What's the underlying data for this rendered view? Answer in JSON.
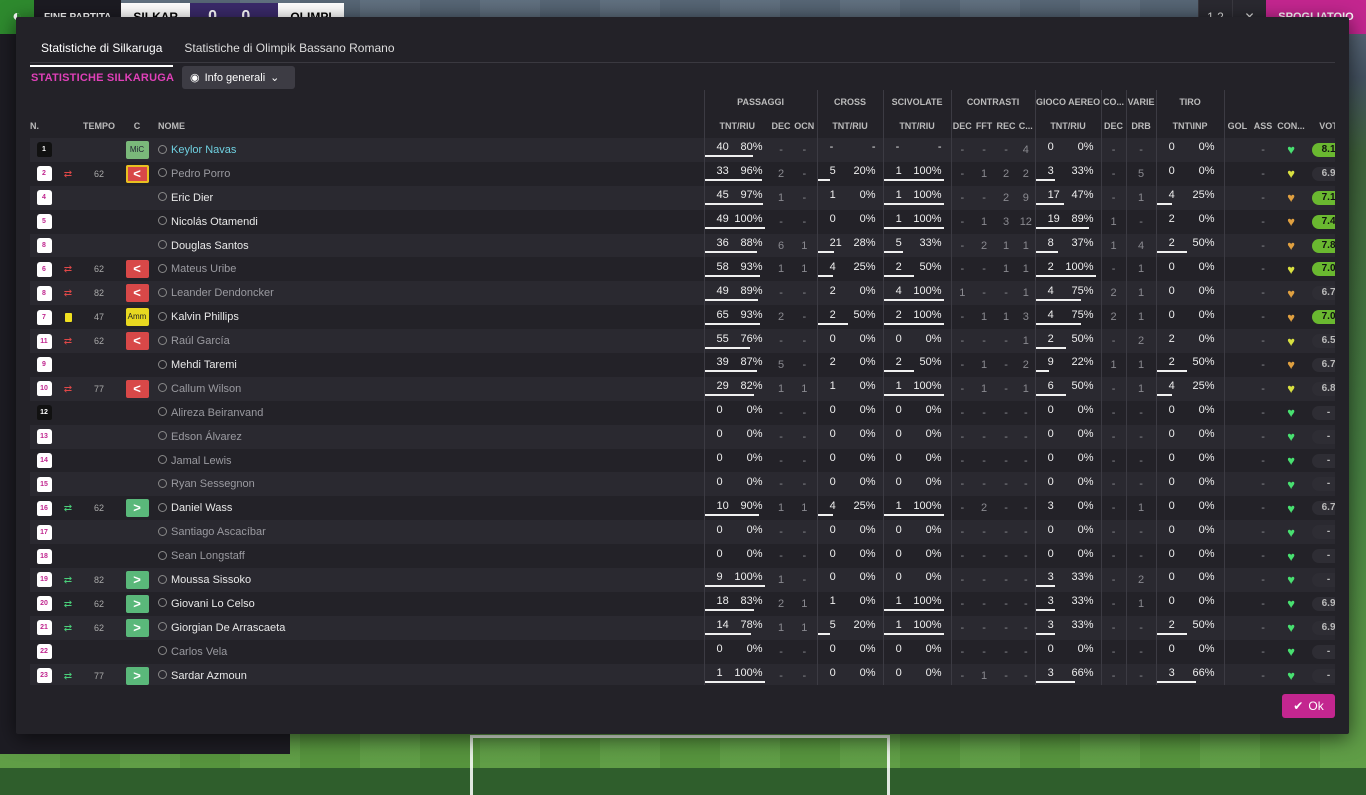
{
  "topbar": {
    "end_label": "FINE PARTITA",
    "home_short": "SILKAR",
    "score": "0 0",
    "away_short": "OLIMPI",
    "right_btn1": "1 2",
    "right_btn2": "✕",
    "right_pink": "SPOGLIATOIO"
  },
  "tabs": [
    {
      "label": "Statistiche di Silkaruga"
    },
    {
      "label": "Statistiche di Olimpik Bassano Romano"
    }
  ],
  "section_title": "STATISTICHE SILKARUGA",
  "dropdown": {
    "label": "Info generali"
  },
  "groups": {
    "passaggi": "PASSAGGI",
    "cross": "CROSS",
    "scivolate": "SCIVOLATE",
    "contrasti": "CONTRASTI",
    "gioco_aereo": "GIOCO AEREO",
    "co": "CO...",
    "varie": "VARIE",
    "tiro": "TIRO"
  },
  "cols": {
    "n": "N.",
    "tempo": "TEMPO",
    "c": "C",
    "nome": "NOME",
    "tnt_riu": "TNT/RIU",
    "dec": "DEC",
    "ocn": "OCN",
    "fft": "FFT",
    "rec": "REC",
    "cx": "C...",
    "drb": "DRB",
    "tnt_inp": "TNT\\INP",
    "gol": "GOL",
    "ass": "ASS",
    "con": "CON...",
    "vot": "VOT"
  },
  "ok_label": "Ok",
  "players": [
    {
      "n": "1",
      "shirt": "black",
      "tempo": "",
      "swap": "",
      "pos": "MiC",
      "pos_type": "gk",
      "name": "Keylor Navas",
      "name_style": "gk",
      "p": [
        "40",
        "80%"
      ],
      "pf": 0.8,
      "pdec": "-",
      "pocn": "-",
      "cr": [
        "-",
        "-"
      ],
      "crf": 0,
      "cr_dash": true,
      "sc": [
        "-",
        "-"
      ],
      "scf": 0,
      "sc_dash": true,
      "cdec": "-",
      "cfft": "-",
      "crec": "-",
      "cc": "4",
      "ga": [
        "0",
        "0%"
      ],
      "gaf": 0,
      "codec": "-",
      "drb": "-",
      "t": [
        "0",
        "0%"
      ],
      "tf": 0,
      "gol": "",
      "ass": "-",
      "heart": "g",
      "vot": "8.1",
      "vot_type": "g"
    },
    {
      "n": "2",
      "shirt": "white",
      "tempo": "62",
      "swap": "out",
      "pos": "<",
      "pos_type": "out-warn",
      "name": "Pedro Porro",
      "name_style": "dim",
      "p": [
        "33",
        "96%"
      ],
      "pf": 0.96,
      "pdec": "2",
      "pocn": "-",
      "cr": [
        "5",
        "20%"
      ],
      "crf": 0.2,
      "sc": [
        "1",
        "100%"
      ],
      "scf": 1,
      "cdec": "-",
      "cfft": "1",
      "crec": "2",
      "cc": "2",
      "ga": [
        "3",
        "33%"
      ],
      "gaf": 0.33,
      "codec": "-",
      "drb": "5",
      "t": [
        "0",
        "0%"
      ],
      "tf": 0,
      "gol": "",
      "ass": "-",
      "heart": "y",
      "vot": "6.9",
      "vot_type": "n"
    },
    {
      "n": "4",
      "shirt": "white",
      "tempo": "",
      "swap": "",
      "pos": "",
      "pos_type": "",
      "name": "Eric Dier",
      "name_style": "",
      "p": [
        "45",
        "97%"
      ],
      "pf": 0.97,
      "pdec": "1",
      "pocn": "-",
      "cr": [
        "1",
        "0%"
      ],
      "crf": 0,
      "sc": [
        "1",
        "100%"
      ],
      "scf": 1,
      "cdec": "-",
      "cfft": "-",
      "crec": "2",
      "cc": "9",
      "ga": [
        "17",
        "47%"
      ],
      "gaf": 0.47,
      "codec": "-",
      "drb": "1",
      "t": [
        "4",
        "25%"
      ],
      "tf": 0.25,
      "gol": "",
      "ass": "-",
      "heart": "o",
      "vot": "7.1",
      "vot_type": "g"
    },
    {
      "n": "5",
      "shirt": "white",
      "tempo": "",
      "swap": "",
      "pos": "",
      "pos_type": "",
      "name": "Nicolás Otamendi",
      "name_style": "",
      "p": [
        "49",
        "100%"
      ],
      "pf": 1,
      "pdec": "-",
      "pocn": "-",
      "cr": [
        "0",
        "0%"
      ],
      "crf": 0,
      "sc": [
        "1",
        "100%"
      ],
      "scf": 1,
      "cdec": "-",
      "cfft": "1",
      "crec": "3",
      "cc": "12",
      "ga": [
        "19",
        "89%"
      ],
      "gaf": 0.89,
      "codec": "1",
      "drb": "-",
      "t": [
        "2",
        "0%"
      ],
      "tf": 0,
      "gol": "",
      "ass": "-",
      "heart": "o",
      "vot": "7.4",
      "vot_type": "g"
    },
    {
      "n": "8",
      "shirt": "white",
      "tempo": "",
      "swap": "",
      "pos": "",
      "pos_type": "",
      "name": "Douglas Santos",
      "name_style": "",
      "p": [
        "36",
        "88%"
      ],
      "pf": 0.88,
      "pdec": "6",
      "pocn": "1",
      "cr": [
        "21",
        "28%"
      ],
      "crf": 0.28,
      "sc": [
        "5",
        "33%"
      ],
      "scf": 0.33,
      "cdec": "-",
      "cfft": "2",
      "crec": "1",
      "cc": "1",
      "ga": [
        "8",
        "37%"
      ],
      "gaf": 0.37,
      "codec": "1",
      "drb": "4",
      "t": [
        "2",
        "50%"
      ],
      "tf": 0.5,
      "gol": "",
      "ass": "-",
      "heart": "o",
      "vot": "7.8",
      "vot_type": "g"
    },
    {
      "n": "6",
      "shirt": "white",
      "tempo": "62",
      "swap": "out",
      "pos": "<",
      "pos_type": "out",
      "name": "Mateus Uribe",
      "name_style": "dim",
      "p": [
        "58",
        "93%"
      ],
      "pf": 0.93,
      "pdec": "1",
      "pocn": "1",
      "cr": [
        "4",
        "25%"
      ],
      "crf": 0.25,
      "sc": [
        "2",
        "50%"
      ],
      "scf": 0.5,
      "cdec": "-",
      "cfft": "-",
      "crec": "1",
      "cc": "1",
      "ga": [
        "2",
        "100%"
      ],
      "gaf": 1,
      "codec": "-",
      "drb": "1",
      "t": [
        "0",
        "0%"
      ],
      "tf": 0,
      "gol": "",
      "ass": "-",
      "heart": "y",
      "vot": "7.0",
      "vot_type": "g"
    },
    {
      "n": "8",
      "shirt": "white",
      "tempo": "82",
      "swap": "out",
      "pos": "<",
      "pos_type": "out",
      "name": "Leander Dendoncker",
      "name_style": "dim",
      "p": [
        "49",
        "89%"
      ],
      "pf": 0.89,
      "pdec": "-",
      "pocn": "-",
      "cr": [
        "2",
        "0%"
      ],
      "crf": 0,
      "sc": [
        "4",
        "100%"
      ],
      "scf": 1,
      "cdec": "1",
      "cfft": "-",
      "crec": "-",
      "cc": "1",
      "ga": [
        "4",
        "75%"
      ],
      "gaf": 0.75,
      "codec": "2",
      "drb": "1",
      "t": [
        "0",
        "0%"
      ],
      "tf": 0,
      "gol": "",
      "ass": "-",
      "heart": "o",
      "vot": "6.7",
      "vot_type": "n"
    },
    {
      "n": "7",
      "shirt": "white",
      "tempo": "47",
      "swap": "yellow",
      "pos": "Amm",
      "pos_type": "y",
      "name": "Kalvin Phillips",
      "name_style": "",
      "p": [
        "65",
        "93%"
      ],
      "pf": 0.93,
      "pdec": "2",
      "pocn": "-",
      "cr": [
        "2",
        "50%"
      ],
      "crf": 0.5,
      "sc": [
        "2",
        "100%"
      ],
      "scf": 1,
      "cdec": "-",
      "cfft": "1",
      "crec": "1",
      "cc": "3",
      "ga": [
        "4",
        "75%"
      ],
      "gaf": 0.75,
      "codec": "2",
      "drb": "1",
      "t": [
        "0",
        "0%"
      ],
      "tf": 0,
      "gol": "",
      "ass": "-",
      "heart": "o",
      "vot": "7.0",
      "vot_type": "g"
    },
    {
      "n": "11",
      "shirt": "white",
      "tempo": "62",
      "swap": "out",
      "pos": "<",
      "pos_type": "out",
      "name": "Raúl García",
      "name_style": "dim",
      "p": [
        "55",
        "76%"
      ],
      "pf": 0.76,
      "pdec": "-",
      "pocn": "-",
      "cr": [
        "0",
        "0%"
      ],
      "crf": 0,
      "sc": [
        "0",
        "0%"
      ],
      "scf": 0,
      "cdec": "-",
      "cfft": "-",
      "crec": "-",
      "cc": "1",
      "ga": [
        "2",
        "50%"
      ],
      "gaf": 0.5,
      "codec": "-",
      "drb": "2",
      "t": [
        "2",
        "0%"
      ],
      "tf": 0,
      "gol": "",
      "ass": "-",
      "heart": "y",
      "vot": "6.5",
      "vot_type": "n"
    },
    {
      "n": "9",
      "shirt": "white",
      "tempo": "",
      "swap": "",
      "pos": "",
      "pos_type": "",
      "name": "Mehdi Taremi",
      "name_style": "",
      "p": [
        "39",
        "87%"
      ],
      "pf": 0.87,
      "pdec": "5",
      "pocn": "-",
      "cr": [
        "2",
        "0%"
      ],
      "crf": 0,
      "sc": [
        "2",
        "50%"
      ],
      "scf": 0.5,
      "cdec": "-",
      "cfft": "1",
      "crec": "-",
      "cc": "2",
      "ga": [
        "9",
        "22%"
      ],
      "gaf": 0.22,
      "codec": "1",
      "drb": "1",
      "t": [
        "2",
        "50%"
      ],
      "tf": 0.5,
      "gol": "",
      "ass": "-",
      "heart": "o",
      "vot": "6.7",
      "vot_type": "n"
    },
    {
      "n": "10",
      "shirt": "white",
      "tempo": "77",
      "swap": "out",
      "pos": "<",
      "pos_type": "out",
      "name": "Callum Wilson",
      "name_style": "dim",
      "p": [
        "29",
        "82%"
      ],
      "pf": 0.82,
      "pdec": "1",
      "pocn": "1",
      "cr": [
        "1",
        "0%"
      ],
      "crf": 0,
      "sc": [
        "1",
        "100%"
      ],
      "scf": 1,
      "cdec": "-",
      "cfft": "1",
      "crec": "-",
      "cc": "1",
      "ga": [
        "6",
        "50%"
      ],
      "gaf": 0.5,
      "codec": "-",
      "drb": "1",
      "t": [
        "4",
        "25%"
      ],
      "tf": 0.25,
      "gol": "",
      "ass": "-",
      "heart": "y",
      "vot": "6.8",
      "vot_type": "n"
    },
    {
      "n": "12",
      "shirt": "black",
      "tempo": "",
      "swap": "",
      "pos": "",
      "pos_type": "",
      "name": "Alireza Beiranvand",
      "name_style": "dim",
      "p": [
        "0",
        "0%"
      ],
      "pf": 0,
      "pdec": "-",
      "pocn": "-",
      "cr": [
        "0",
        "0%"
      ],
      "crf": 0,
      "sc": [
        "0",
        "0%"
      ],
      "scf": 0,
      "cdec": "-",
      "cfft": "-",
      "crec": "-",
      "cc": "-",
      "ga": [
        "0",
        "0%"
      ],
      "gaf": 0,
      "codec": "-",
      "drb": "-",
      "t": [
        "0",
        "0%"
      ],
      "tf": 0,
      "gol": "",
      "ass": "-",
      "heart": "g",
      "vot": "-",
      "vot_type": "n"
    },
    {
      "n": "13",
      "shirt": "white",
      "tempo": "",
      "swap": "",
      "pos": "",
      "pos_type": "",
      "name": "Edson Álvarez",
      "name_style": "dim",
      "p": [
        "0",
        "0%"
      ],
      "pf": 0,
      "pdec": "-",
      "pocn": "-",
      "cr": [
        "0",
        "0%"
      ],
      "crf": 0,
      "sc": [
        "0",
        "0%"
      ],
      "scf": 0,
      "cdec": "-",
      "cfft": "-",
      "crec": "-",
      "cc": "-",
      "ga": [
        "0",
        "0%"
      ],
      "gaf": 0,
      "codec": "-",
      "drb": "-",
      "t": [
        "0",
        "0%"
      ],
      "tf": 0,
      "gol": "",
      "ass": "-",
      "heart": "g",
      "vot": "-",
      "vot_type": "n"
    },
    {
      "n": "14",
      "shirt": "white",
      "tempo": "",
      "swap": "",
      "pos": "",
      "pos_type": "",
      "name": "Jamal Lewis",
      "name_style": "dim",
      "p": [
        "0",
        "0%"
      ],
      "pf": 0,
      "pdec": "-",
      "pocn": "-",
      "cr": [
        "0",
        "0%"
      ],
      "crf": 0,
      "sc": [
        "0",
        "0%"
      ],
      "scf": 0,
      "cdec": "-",
      "cfft": "-",
      "crec": "-",
      "cc": "-",
      "ga": [
        "0",
        "0%"
      ],
      "gaf": 0,
      "codec": "-",
      "drb": "-",
      "t": [
        "0",
        "0%"
      ],
      "tf": 0,
      "gol": "",
      "ass": "-",
      "heart": "g",
      "vot": "-",
      "vot_type": "n"
    },
    {
      "n": "15",
      "shirt": "white",
      "tempo": "",
      "swap": "",
      "pos": "",
      "pos_type": "",
      "name": "Ryan Sessegnon",
      "name_style": "dim",
      "p": [
        "0",
        "0%"
      ],
      "pf": 0,
      "pdec": "-",
      "pocn": "-",
      "cr": [
        "0",
        "0%"
      ],
      "crf": 0,
      "sc": [
        "0",
        "0%"
      ],
      "scf": 0,
      "cdec": "-",
      "cfft": "-",
      "crec": "-",
      "cc": "-",
      "ga": [
        "0",
        "0%"
      ],
      "gaf": 0,
      "codec": "-",
      "drb": "-",
      "t": [
        "0",
        "0%"
      ],
      "tf": 0,
      "gol": "",
      "ass": "-",
      "heart": "g",
      "vot": "-",
      "vot_type": "n"
    },
    {
      "n": "16",
      "shirt": "white",
      "tempo": "62",
      "swap": "in",
      "pos": ">",
      "pos_type": "in",
      "name": "Daniel Wass",
      "name_style": "",
      "p": [
        "10",
        "90%"
      ],
      "pf": 0.9,
      "pdec": "1",
      "pocn": "1",
      "cr": [
        "4",
        "25%"
      ],
      "crf": 0.25,
      "sc": [
        "1",
        "100%"
      ],
      "scf": 1,
      "cdec": "-",
      "cfft": "2",
      "crec": "-",
      "cc": "-",
      "ga": [
        "3",
        "0%"
      ],
      "gaf": 0,
      "codec": "-",
      "drb": "1",
      "t": [
        "0",
        "0%"
      ],
      "tf": 0,
      "gol": "",
      "ass": "-",
      "heart": "g",
      "vot": "6.7",
      "vot_type": "n"
    },
    {
      "n": "17",
      "shirt": "white",
      "tempo": "",
      "swap": "",
      "pos": "",
      "pos_type": "",
      "name": "Santiago Ascacíbar",
      "name_style": "dim",
      "p": [
        "0",
        "0%"
      ],
      "pf": 0,
      "pdec": "-",
      "pocn": "-",
      "cr": [
        "0",
        "0%"
      ],
      "crf": 0,
      "sc": [
        "0",
        "0%"
      ],
      "scf": 0,
      "cdec": "-",
      "cfft": "-",
      "crec": "-",
      "cc": "-",
      "ga": [
        "0",
        "0%"
      ],
      "gaf": 0,
      "codec": "-",
      "drb": "-",
      "t": [
        "0",
        "0%"
      ],
      "tf": 0,
      "gol": "",
      "ass": "-",
      "heart": "g",
      "vot": "-",
      "vot_type": "n"
    },
    {
      "n": "18",
      "shirt": "white",
      "tempo": "",
      "swap": "",
      "pos": "",
      "pos_type": "",
      "name": "Sean Longstaff",
      "name_style": "dim",
      "p": [
        "0",
        "0%"
      ],
      "pf": 0,
      "pdec": "-",
      "pocn": "-",
      "cr": [
        "0",
        "0%"
      ],
      "crf": 0,
      "sc": [
        "0",
        "0%"
      ],
      "scf": 0,
      "cdec": "-",
      "cfft": "-",
      "crec": "-",
      "cc": "-",
      "ga": [
        "0",
        "0%"
      ],
      "gaf": 0,
      "codec": "-",
      "drb": "-",
      "t": [
        "0",
        "0%"
      ],
      "tf": 0,
      "gol": "",
      "ass": "-",
      "heart": "g",
      "vot": "-",
      "vot_type": "n"
    },
    {
      "n": "19",
      "shirt": "white",
      "tempo": "82",
      "swap": "in",
      "pos": ">",
      "pos_type": "in",
      "name": "Moussa Sissoko",
      "name_style": "",
      "p": [
        "9",
        "100%"
      ],
      "pf": 1,
      "pdec": "1",
      "pocn": "-",
      "cr": [
        "0",
        "0%"
      ],
      "crf": 0,
      "sc": [
        "0",
        "0%"
      ],
      "scf": 0,
      "cdec": "-",
      "cfft": "-",
      "crec": "-",
      "cc": "-",
      "ga": [
        "3",
        "33%"
      ],
      "gaf": 0.33,
      "codec": "-",
      "drb": "2",
      "t": [
        "0",
        "0%"
      ],
      "tf": 0,
      "gol": "",
      "ass": "-",
      "heart": "g",
      "vot": "-",
      "vot_type": "n"
    },
    {
      "n": "20",
      "shirt": "white",
      "tempo": "62",
      "swap": "in",
      "pos": ">",
      "pos_type": "in",
      "name": "Giovani Lo Celso",
      "name_style": "",
      "p": [
        "18",
        "83%"
      ],
      "pf": 0.83,
      "pdec": "2",
      "pocn": "1",
      "cr": [
        "1",
        "0%"
      ],
      "crf": 0,
      "sc": [
        "1",
        "100%"
      ],
      "scf": 1,
      "cdec": "-",
      "cfft": "-",
      "crec": "-",
      "cc": "-",
      "ga": [
        "3",
        "33%"
      ],
      "gaf": 0.33,
      "codec": "-",
      "drb": "1",
      "t": [
        "0",
        "0%"
      ],
      "tf": 0,
      "gol": "",
      "ass": "-",
      "heart": "g",
      "vot": "6.9",
      "vot_type": "n"
    },
    {
      "n": "21",
      "shirt": "white",
      "tempo": "62",
      "swap": "in",
      "pos": ">",
      "pos_type": "in",
      "name": "Giorgian De Arrascaeta",
      "name_style": "",
      "p": [
        "14",
        "78%"
      ],
      "pf": 0.78,
      "pdec": "1",
      "pocn": "1",
      "cr": [
        "5",
        "20%"
      ],
      "crf": 0.2,
      "sc": [
        "1",
        "100%"
      ],
      "scf": 1,
      "cdec": "-",
      "cfft": "-",
      "crec": "-",
      "cc": "-",
      "ga": [
        "3",
        "33%"
      ],
      "gaf": 0.33,
      "codec": "-",
      "drb": "-",
      "t": [
        "2",
        "50%"
      ],
      "tf": 0.5,
      "gol": "",
      "ass": "-",
      "heart": "g",
      "vot": "6.9",
      "vot_type": "n"
    },
    {
      "n": "22",
      "shirt": "white",
      "tempo": "",
      "swap": "",
      "pos": "",
      "pos_type": "",
      "name": "Carlos Vela",
      "name_style": "dim",
      "p": [
        "0",
        "0%"
      ],
      "pf": 0,
      "pdec": "-",
      "pocn": "-",
      "cr": [
        "0",
        "0%"
      ],
      "crf": 0,
      "sc": [
        "0",
        "0%"
      ],
      "scf": 0,
      "cdec": "-",
      "cfft": "-",
      "crec": "-",
      "cc": "-",
      "ga": [
        "0",
        "0%"
      ],
      "gaf": 0,
      "codec": "-",
      "drb": "-",
      "t": [
        "0",
        "0%"
      ],
      "tf": 0,
      "gol": "",
      "ass": "-",
      "heart": "g",
      "vot": "-",
      "vot_type": "n"
    },
    {
      "n": "23",
      "shirt": "white",
      "tempo": "77",
      "swap": "in",
      "pos": ">",
      "pos_type": "in",
      "name": "Sardar Azmoun",
      "name_style": "",
      "p": [
        "1",
        "100%"
      ],
      "pf": 1,
      "pdec": "-",
      "pocn": "-",
      "cr": [
        "0",
        "0%"
      ],
      "crf": 0,
      "sc": [
        "0",
        "0%"
      ],
      "scf": 0,
      "cdec": "-",
      "cfft": "1",
      "crec": "-",
      "cc": "-",
      "ga": [
        "3",
        "66%"
      ],
      "gaf": 0.66,
      "codec": "-",
      "drb": "-",
      "t": [
        "3",
        "66%"
      ],
      "tf": 0.66,
      "gol": "",
      "ass": "-",
      "heart": "g",
      "vot": "-",
      "vot_type": "n"
    }
  ]
}
